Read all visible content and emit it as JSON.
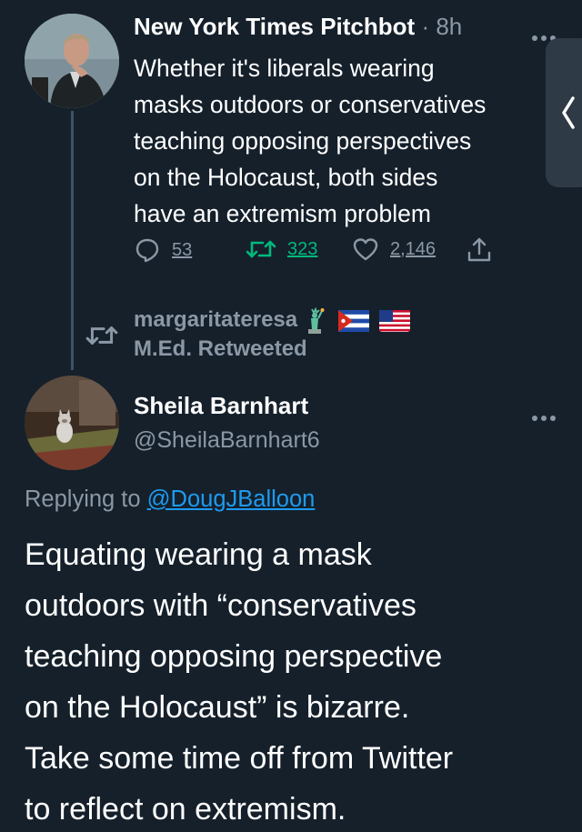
{
  "tweet1": {
    "author_name": "New York Times Pitchbot",
    "separator": "·",
    "time": "8h",
    "more_icon": "more-horizontal-icon",
    "text": "Whether it's liberals wearing\nmasks outdoors or conservatives\nteaching opposing perspectives\non the Holocaust, both sides\nhave an extremism problem",
    "actions": {
      "reply_count": "53",
      "retweet_count": "323",
      "like_count": "2,146",
      "reply_icon": "reply-bubble-icon",
      "retweet_icon": "retweet-icon",
      "like_icon": "heart-icon",
      "share_icon": "share-icon"
    }
  },
  "retweet_banner": {
    "line1": "margaritateresa",
    "line2": "M.Ed. Retweeted",
    "icon": "retweet-icon",
    "emoji": [
      "statue-of-liberty",
      "cuba-flag",
      "usa-flag"
    ]
  },
  "tweet2": {
    "author_name": "Sheila Barnhart",
    "handle": "@SheilaBarnhart6",
    "more_icon": "more-horizontal-icon",
    "replying_prefix": "Replying to",
    "replying_to": "@DougJBalloon",
    "text": "Equating wearing a mask\noutdoors with “conservatives\nteaching opposing perspective\non the Holocaust” is bizarre.\nTake some time off from Twitter\nto reflect on extremism."
  },
  "side_tab": {
    "icon": "chevron-left-icon"
  },
  "colors": {
    "background": "#15202b",
    "secondary_text": "#8b98a5",
    "link": "#1d9bf0",
    "retweet_green": "#00ba7c",
    "thread_line": "#3d5466"
  }
}
